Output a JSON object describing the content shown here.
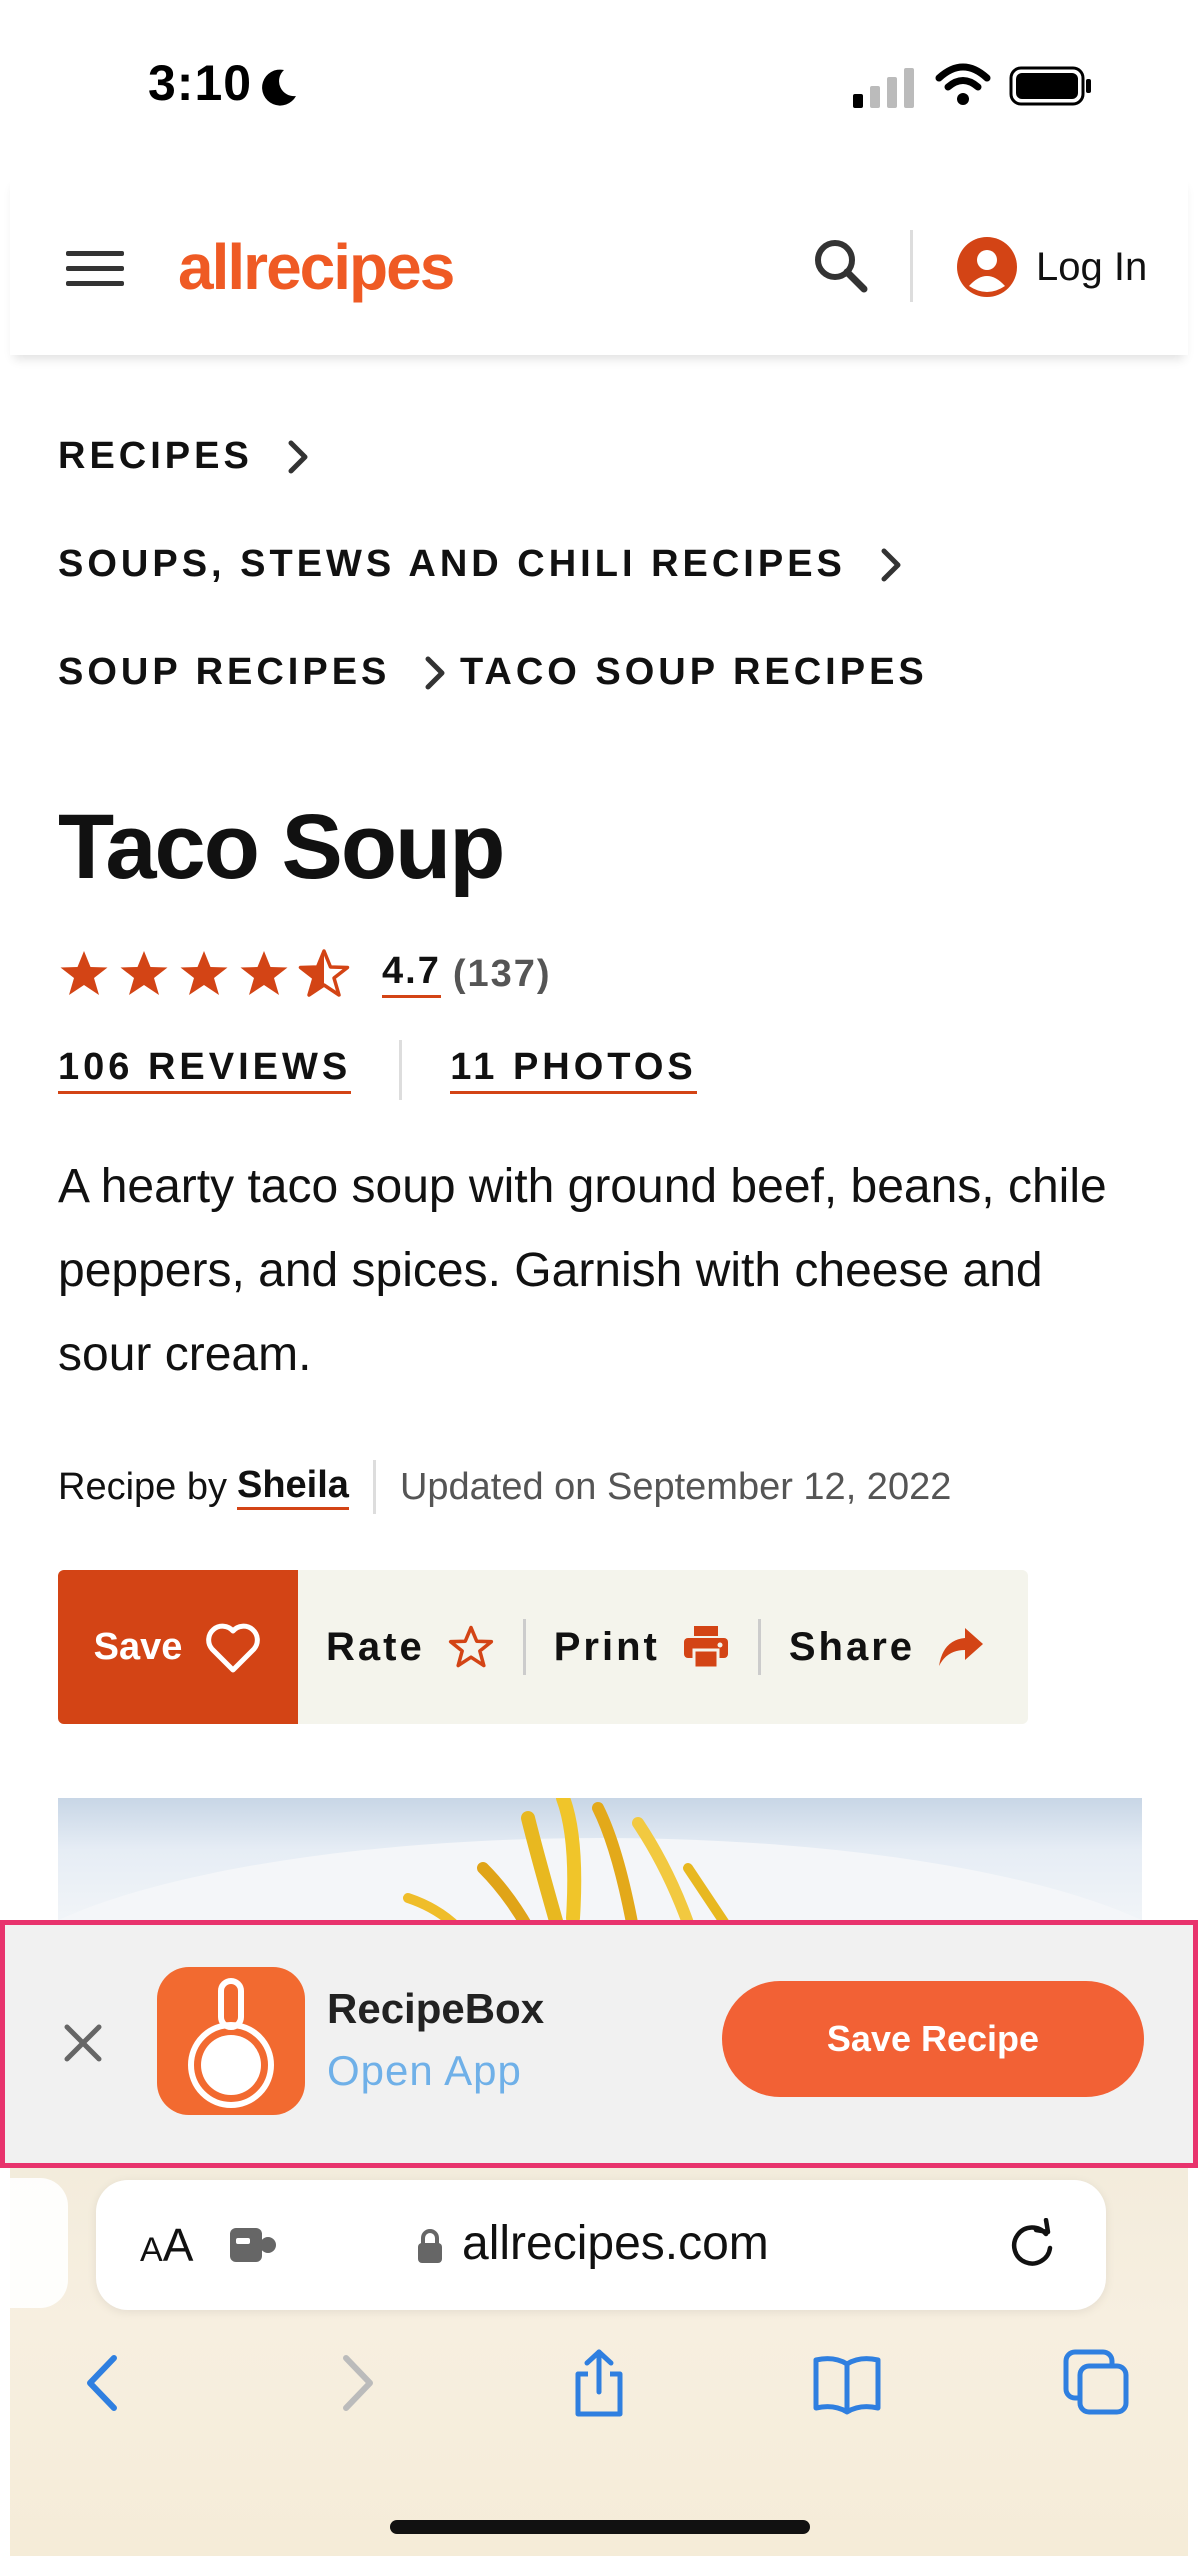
{
  "status_bar": {
    "time": "3:10"
  },
  "header": {
    "logo_text": "allrecipes",
    "login_label": "Log In"
  },
  "breadcrumbs": [
    {
      "label": "RECIPES"
    },
    {
      "label": "SOUPS, STEWS AND CHILI RECIPES"
    },
    {
      "label": "SOUP RECIPES"
    },
    {
      "label": "TACO SOUP RECIPES"
    }
  ],
  "recipe": {
    "title": "Taco Soup",
    "rating": "4.7",
    "rating_count": "(137)",
    "reviews_link": "106 REVIEWS",
    "photos_link": "11 PHOTOS",
    "description": "A hearty taco soup with ground beef, beans, chile peppers, and spices. Garnish with cheese and sour cream.",
    "byline_prefix": "Recipe by",
    "author": "Sheila",
    "updated": "Updated on September 12, 2022"
  },
  "actions": {
    "save": "Save",
    "rate": "Rate",
    "print": "Print",
    "share": "Share"
  },
  "app_banner": {
    "app_name": "RecipeBox",
    "open_app": "Open App",
    "cta": "Save Recipe"
  },
  "browser": {
    "aa_label_small": "A",
    "aa_label_large": "A",
    "url": "allrecipes.com"
  },
  "colors": {
    "brand": "#d34415",
    "logo": "#ef5a24",
    "banner_cta": "#f26135",
    "banner_highlight": "#e8336d",
    "ios_blue": "#2f7fe0"
  },
  "icons": {
    "menu": "hamburger-menu-icon",
    "search": "search-icon",
    "user": "user-icon",
    "star": "star-icon",
    "heart": "heart-icon",
    "print": "printer-icon",
    "share": "share-arrow-icon",
    "close": "close-icon",
    "reload": "reload-icon"
  }
}
